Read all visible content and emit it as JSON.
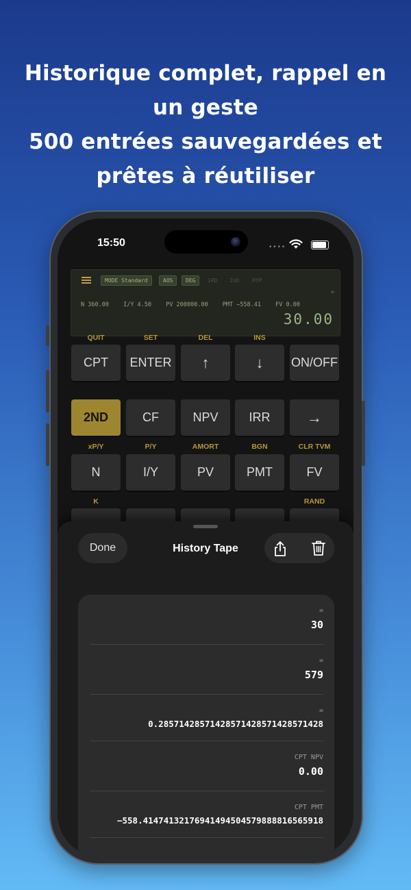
{
  "headline": {
    "line1": "Historique complet, rappel en",
    "line2": "un geste",
    "line3": "500 entrées sauvegardées et",
    "line4": "prêtes à réutiliser"
  },
  "status_bar": {
    "time": "15:50"
  },
  "display": {
    "tags": [
      "MODE Standard",
      "AOS",
      "DEG",
      "iRD",
      "2nD",
      "HYP"
    ],
    "eq": "=",
    "registers": [
      "N 360.00",
      "I/Y 4.50",
      "PV 200000.00",
      "PMT −558.41",
      "FV 0.00"
    ],
    "value": "30.00"
  },
  "keypad": {
    "row1_labels": [
      "QUIT",
      "SET",
      "DEL",
      "INS",
      ""
    ],
    "row1_keys": [
      "CPT",
      "ENTER",
      "↑",
      "↓",
      "ON/OFF"
    ],
    "row2_keys": [
      "2ND",
      "CF",
      "NPV",
      "IRR",
      "→"
    ],
    "row3_labels": [
      "xP/Y",
      "P/Y",
      "AMORT",
      "BGN",
      "CLR TVM"
    ],
    "row3_keys": [
      "N",
      "I/Y",
      "PV",
      "PMT",
      "FV"
    ],
    "row4_labels": [
      "K",
      "",
      "",
      "",
      "RAND"
    ]
  },
  "history_sheet": {
    "done_label": "Done",
    "title": "History Tape",
    "entries": [
      {
        "label": "=",
        "value": "30"
      },
      {
        "label": "=",
        "value": "579"
      },
      {
        "label": "=",
        "value": "0.28571428571428571428571428571428"
      },
      {
        "label": "CPT NPV",
        "value": "0.00"
      },
      {
        "label": "CPT PMT",
        "value": "−558.4147413217694149450457988881656591​8"
      }
    ]
  },
  "colors": {
    "accent_gold": "#9e8530",
    "lcd_text": "#9db783"
  }
}
